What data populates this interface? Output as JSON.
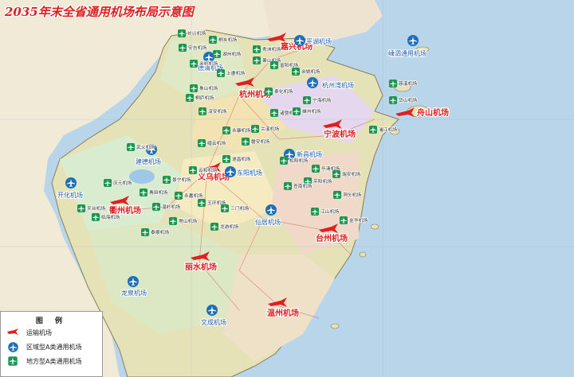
{
  "title": "2035年末全省通用机场布局示意图",
  "legend": {
    "heading": "图 例",
    "items": [
      {
        "key": "transport",
        "label": "运输机场",
        "color": "#e02020"
      },
      {
        "key": "regional",
        "label": "区域型A类通用机场",
        "color": "#1e6fb8"
      },
      {
        "key": "local",
        "label": "地方型A类通用机场",
        "color": "#1a9650"
      }
    ]
  },
  "transport_airports": [
    {
      "name": "嘉兴机场"
    },
    {
      "name": "杭州机场"
    },
    {
      "name": "舟山机场"
    },
    {
      "name": "宁波机场"
    },
    {
      "name": "义乌机场"
    },
    {
      "name": "衢州机场"
    },
    {
      "name": "台州机场"
    },
    {
      "name": "丽水机场"
    },
    {
      "name": "温州机场"
    }
  ],
  "regional_airports": [
    {
      "name": "平湖机场"
    },
    {
      "name": "德清机场"
    },
    {
      "name": "嵊泗通用机场"
    },
    {
      "name": "杭州湾机场"
    },
    {
      "name": "建德机场"
    },
    {
      "name": "新昌机场"
    },
    {
      "name": "东阳机场"
    },
    {
      "name": "开化机场"
    },
    {
      "name": "仙居机场"
    },
    {
      "name": "龙泉机场"
    },
    {
      "name": "文成机场"
    }
  ],
  "local_airports": [
    {
      "name": "长兴机场"
    },
    {
      "name": "安吉机场"
    },
    {
      "name": "桐乡机场"
    },
    {
      "name": "秀洲机场"
    },
    {
      "name": "湖州机场"
    },
    {
      "name": "余杭机场"
    },
    {
      "name": "萧山机场"
    },
    {
      "name": "富阳机场"
    },
    {
      "name": "上虞机场"
    },
    {
      "name": "余姚机场"
    },
    {
      "name": "慈溪机场"
    },
    {
      "name": "岱山机场"
    },
    {
      "name": "象山机场"
    },
    {
      "name": "奉化机场"
    },
    {
      "name": "宁海机场"
    },
    {
      "name": "诸暨机场"
    },
    {
      "name": "嵊州机场"
    },
    {
      "name": "桐庐机场"
    },
    {
      "name": "淳安机场"
    },
    {
      "name": "兰溪机场"
    },
    {
      "name": "浦江机场"
    },
    {
      "name": "永康机场"
    },
    {
      "name": "武义机场"
    },
    {
      "name": "磐安机场"
    },
    {
      "name": "缙云机场"
    },
    {
      "name": "遂昌机场"
    },
    {
      "name": "松阳机场"
    },
    {
      "name": "云和机场"
    },
    {
      "name": "景宁机场"
    },
    {
      "name": "庆元机场"
    },
    {
      "name": "青田机场"
    },
    {
      "name": "永嘉机场"
    },
    {
      "name": "乐清机场"
    },
    {
      "name": "瑞安机场"
    },
    {
      "name": "平阳机场"
    },
    {
      "name": "苍南机场"
    },
    {
      "name": "洞头机场"
    },
    {
      "name": "温岭机场"
    },
    {
      "name": "玉环机场"
    },
    {
      "name": "三门机场"
    },
    {
      "name": "天台机场"
    },
    {
      "name": "临海机场"
    },
    {
      "name": "江山机场"
    },
    {
      "name": "常山机场"
    },
    {
      "name": "龙游机场"
    },
    {
      "name": "金华机场"
    },
    {
      "name": "泰顺机场"
    }
  ]
}
